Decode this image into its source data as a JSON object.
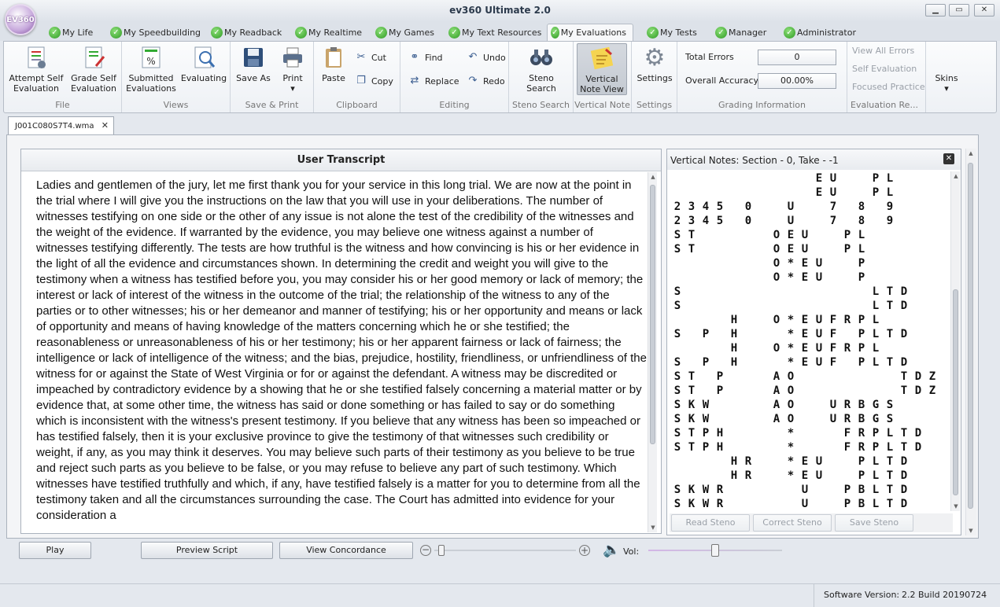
{
  "app": {
    "title": "ev360 Ultimate 2.0",
    "logo_text": "EV360"
  },
  "window_controls": [
    "minimize",
    "maximize",
    "close"
  ],
  "tabs": [
    {
      "label": "My Life",
      "active": false
    },
    {
      "label": "My Speedbuilding",
      "active": false
    },
    {
      "label": "My Readback",
      "active": false
    },
    {
      "label": "My Realtime",
      "active": false
    },
    {
      "label": "My Games",
      "active": false
    },
    {
      "label": "My Text Resources",
      "active": false
    },
    {
      "label": "My Evaluations",
      "active": true
    },
    {
      "label": "My Tests",
      "active": false
    },
    {
      "label": "Manager",
      "active": false
    },
    {
      "label": "Administrator",
      "active": false
    }
  ],
  "ribbon": {
    "file": {
      "label": "File",
      "attempt_self": "Attempt Self",
      "attempt_self2": "Evaluation",
      "grade_self": "Grade Self",
      "grade_self2": "Evaluation"
    },
    "views": {
      "label": "Views",
      "submitted": "Submitted",
      "submitted2": "Evaluations",
      "evaluating": "Evaluating"
    },
    "save_print": {
      "label": "Save & Print",
      "save_as": "Save As",
      "print": "Print"
    },
    "clipboard": {
      "label": "Clipboard",
      "paste": "Paste",
      "cut": "Cut",
      "copy": "Copy"
    },
    "editing": {
      "label": "Editing",
      "find": "Find",
      "replace": "Replace",
      "undo": "Undo",
      "redo": "Redo"
    },
    "steno_search": {
      "label": "Steno Search",
      "btn1": "Steno",
      "btn2": "Search"
    },
    "vertical_note": {
      "label": "Vertical Note",
      "btn1": "Vertical",
      "btn2": "Note View"
    },
    "settings": {
      "label": "Settings",
      "btn": "Settings"
    },
    "grading": {
      "label": "Grading Information",
      "total_errors_label": "Total Errors",
      "total_errors_value": "0",
      "overall_accuracy_label": "Overall Accuracy",
      "overall_accuracy_value": "00.00%"
    },
    "evaluation_results": {
      "label": "Evaluation Re...",
      "view_all": "View All Errors",
      "self_eval": "Self  Evaluation",
      "focused": "Focused Practice"
    },
    "skins": {
      "label": "Skins"
    }
  },
  "document_tab": {
    "name": "J001C080S7T4.wma"
  },
  "user_transcript": {
    "title": "User Transcript",
    "text": "Ladies and gentlemen of the jury, let me first thank you for your service in this long trial. We are now at the point in the trial where I will give you the instructions on the law that you will use in your deliberations. The number of witnesses testifying on one side or the other of any issue is not alone the test of the credibility of the witnesses and the weight of the evidence. If warranted by the evidence, you may believe one witness against a number of witnesses testifying differently. The tests are how truthful is the witness and how convincing is his or her evidence in the light of all the evidence and circumstances shown.  In determining the credit and weight you will give to the testimony when a witness has testified before you, you may consider his or her good memory or lack of memory; the interest or lack of interest of the witness in the outcome of the trial; the relationship of the witness to any of the parties or to other witnesses; his or her demeanor and manner of testifying; his or her opportunity and means or lack of opportunity and means of having knowledge of the matters concerning which he or she testified; the reasonableness or unreasonableness of his or her testimony; his or her apparent fairness or lack of fairness; the intelligence or lack of intelligence of the witness; and the bias, prejudice, hostility, friendliness, or unfriendliness of the witness for or against the State of West Virginia or for or against the defendant.  A witness may be discredited or impeached by contradictory evidence by a showing that he or she testified falsely concerning a material matter or by evidence that, at some other time, the witness has said or done something or has failed to say or do something which is inconsistent with the witness's present testimony. If you believe that any witness has been so impeached or has testified falsely, then it is your exclusive province to give the testimony of that witnesses such credibility or weight, if any, as you may think it deserves. You may believe such parts of their testimony as you believe to be true and reject such parts as you believe to be false, or you may refuse to believe any part of such testimony.  Which witnesses have testified truthfully and which, if any, have testified falsely is a matter for you to determine from all the testimony taken and all the circumstances surrounding the case. The Court has admitted into evidence for your consideration a"
  },
  "vertical_notes": {
    "title": "Vertical Notes: Section - 0, Take - -1",
    "rows": [
      "          EU  PL   ",
      "          EU  PL   ",
      "2345 0  U  7 8 9   ",
      "2345 0  U  7 8 9   ",
      "ST     OEU  PL    ",
      "ST     OEU  PL    ",
      "       O*EU  P    ",
      "       O*EU  P    ",
      "S             LTD  ",
      "S             LTD  ",
      "    H  O*EUFRPL    ",
      "S P H   *EUF PLTD  ",
      "    H  O*EUFRPL    ",
      "S P H   *EUF PLTD  ",
      "ST P   AO       TDZ",
      "ST P   AO       TDZ",
      "SKW    AO  URBGS   ",
      "SKW    AO  URBGS   ",
      "STPH    *   FRPLTD ",
      "STPH    *   FRPLTD ",
      "    HR  *EU  PLTD  ",
      "    HR  *EU  PLTD  ",
      "SKWR     U  PBLTD  ",
      "SKWR     U  PBLTD  "
    ],
    "read_steno": "Read Steno",
    "correct_steno": "Correct Steno",
    "save_steno": "Save Steno"
  },
  "player": {
    "play": "Play",
    "preview_script": "Preview Script",
    "view_concordance": "View Concordance",
    "vol_label": "Vol:",
    "speed_level": 0.03,
    "volume_level": 0.5
  },
  "status": {
    "version_label": "Software Version:",
    "version_value": "2.2 Build 20190724"
  }
}
